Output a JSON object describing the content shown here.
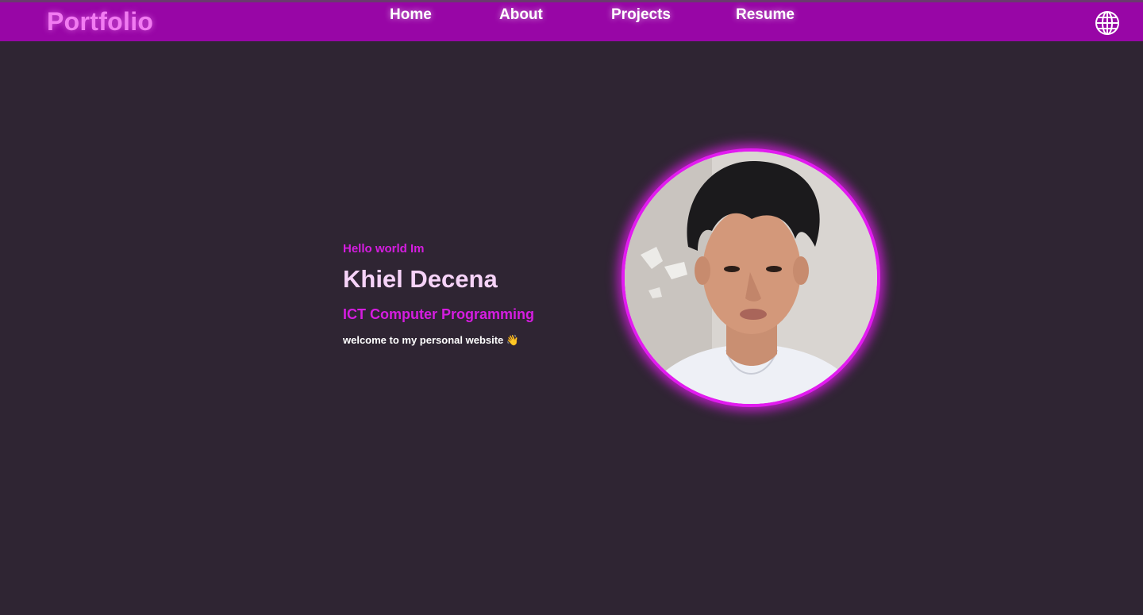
{
  "brand": "Portfolio",
  "nav": {
    "items": [
      {
        "label": "Home"
      },
      {
        "label": "About"
      },
      {
        "label": "Projects"
      },
      {
        "label": "Resume"
      }
    ],
    "language_icon": "globe-icon"
  },
  "hero": {
    "greeting": "Hello world Im",
    "name": "Khiel Decena",
    "role": "ICT Computer Programming",
    "welcome": "welcome to my personal website 👋",
    "photo": "profile-photo"
  },
  "colors": {
    "navbar": "#9806a6",
    "background": "#2f2533",
    "accent": "#d51de0",
    "brand": "#f27bf2",
    "name": "#f6d3f8"
  }
}
